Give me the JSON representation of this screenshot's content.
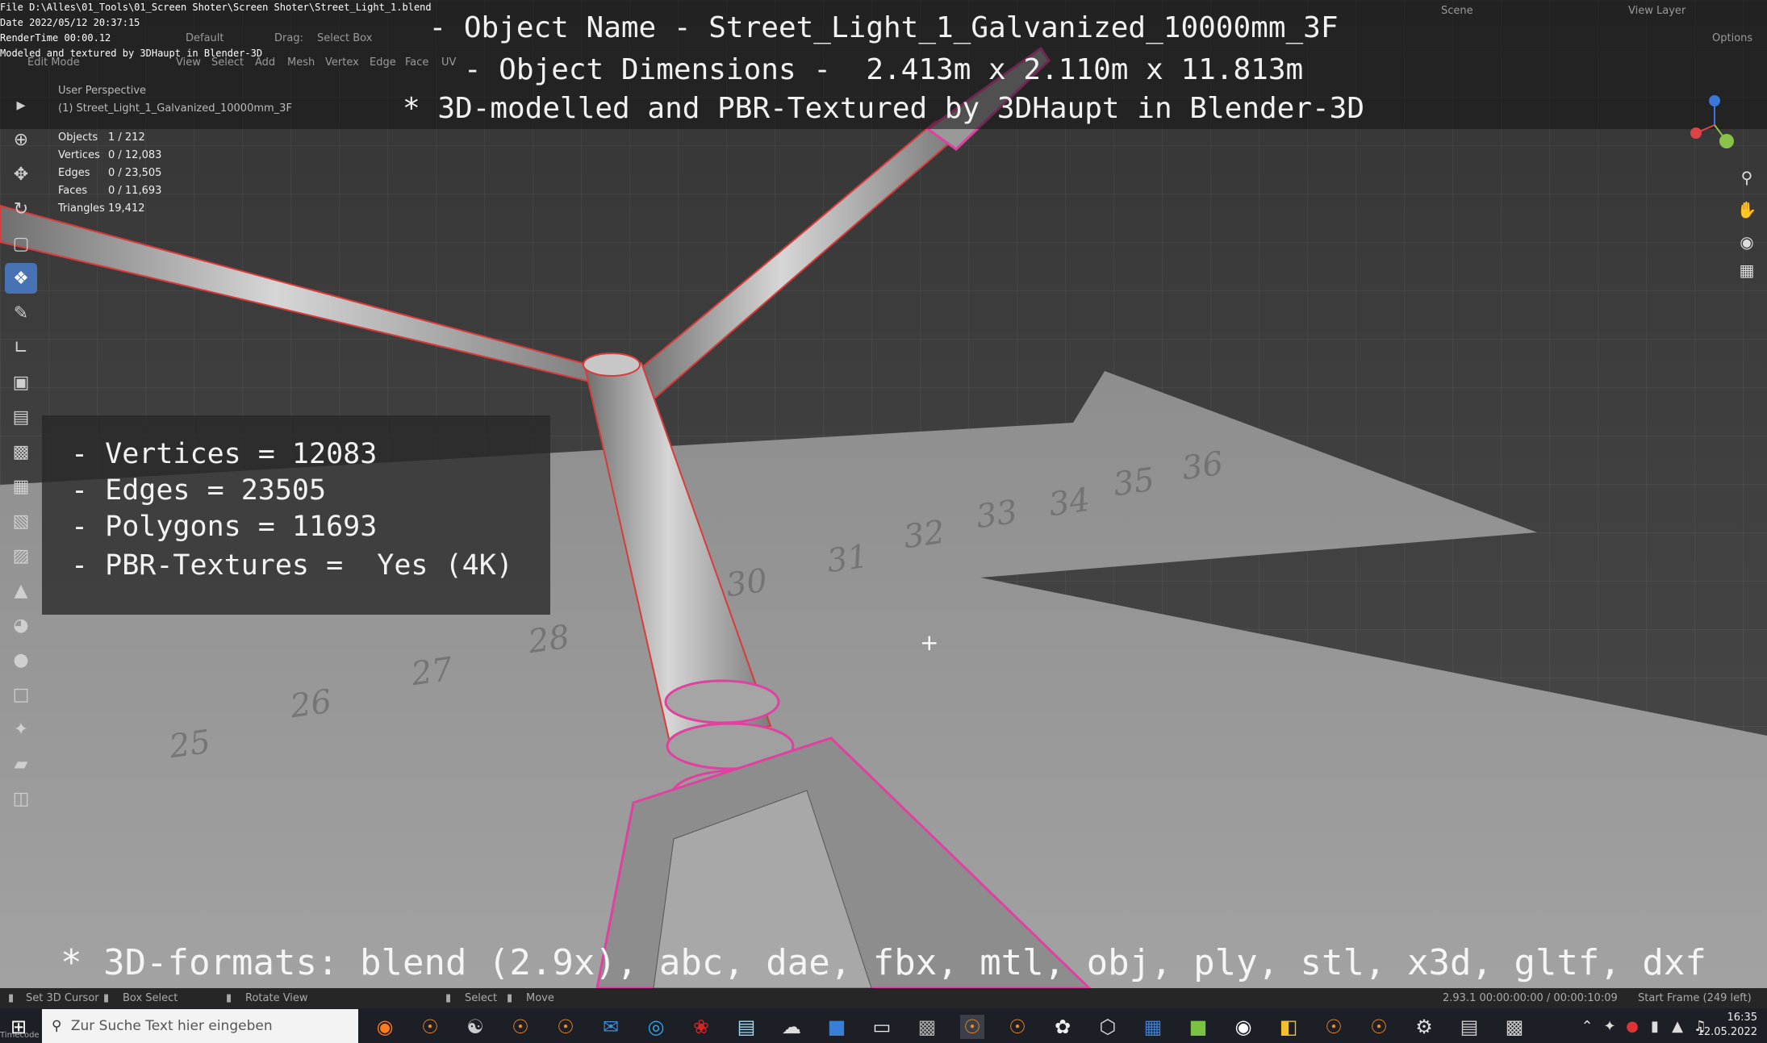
{
  "file_info": {
    "file": "File D:\\Alles\\01_Tools\\01_Screen Shoter\\Screen Shoter\\Street_Light_1.blend",
    "date": "Date 2022/05/12 20:37:15",
    "render_time": "RenderTime 00:00.12",
    "modeled_by": "Modeled and textured by 3DHaupt in Blender-3D"
  },
  "header": {
    "mode": "Edit Mode",
    "orientation": "Default",
    "drag_label": "Drag:",
    "drag_value": "Select Box",
    "menus": [
      "View",
      "Select",
      "Add",
      "Mesh",
      "Vertex",
      "Edge",
      "Face",
      "UV"
    ],
    "scene": "Scene",
    "view_layer": "View Layer",
    "options": "Options"
  },
  "overlay": {
    "title_line1": "- Object Name - Street_Light_1_Galvanized_10000mm_3F",
    "title_line2": "- Object Dimensions -  2.413m x 2.110m x 11.813m",
    "title_line3": "* 3D-modelled and PBR-Textured by 3DHaupt in Blender-3D",
    "stats_lines": [
      "- Vertices = 12083",
      "- Edges = 23505",
      "- Polygons = 11693",
      "- PBR-Textures =  Yes (4K)"
    ],
    "formats": "* 3D-formats: blend (2.9x), abc, dae, fbx, mtl, obj, ply, stl, x3d, gltf, dxf"
  },
  "viewport": {
    "perspective": "User Perspective",
    "object_label": "(1) Street_Light_1_Galvanized_10000mm_3F",
    "stats": [
      {
        "k": "Objects",
        "v": "1 / 212"
      },
      {
        "k": "Vertices",
        "v": "0 / 12,083"
      },
      {
        "k": "Edges",
        "v": "0 / 23,505"
      },
      {
        "k": "Faces",
        "v": "0 / 11,693"
      },
      {
        "k": "Triangles",
        "v": "19,412"
      }
    ],
    "ground_labels": [
      "25",
      "26",
      "27",
      "28",
      "30",
      "31",
      "32",
      "33",
      "34",
      "35",
      "36"
    ]
  },
  "statusbar": {
    "set_cursor": "Set 3D Cursor",
    "box_select": "Box Select",
    "rotate_view": "Rotate View",
    "select": "Select",
    "move": "Move",
    "version_time": "2.93.1  00:00:00:00 / 00:00:10:09",
    "start_frame": "Start Frame (249 left)"
  },
  "taskbar": {
    "search_placeholder": "Zur Suche Text hier eingeben",
    "time": "16:35",
    "date": "12.05.2022",
    "timecode": "Timecode"
  },
  "colors": {
    "accent": "#4772b3",
    "edge_selected": "#e040a0",
    "seam": "#d93a3a"
  }
}
